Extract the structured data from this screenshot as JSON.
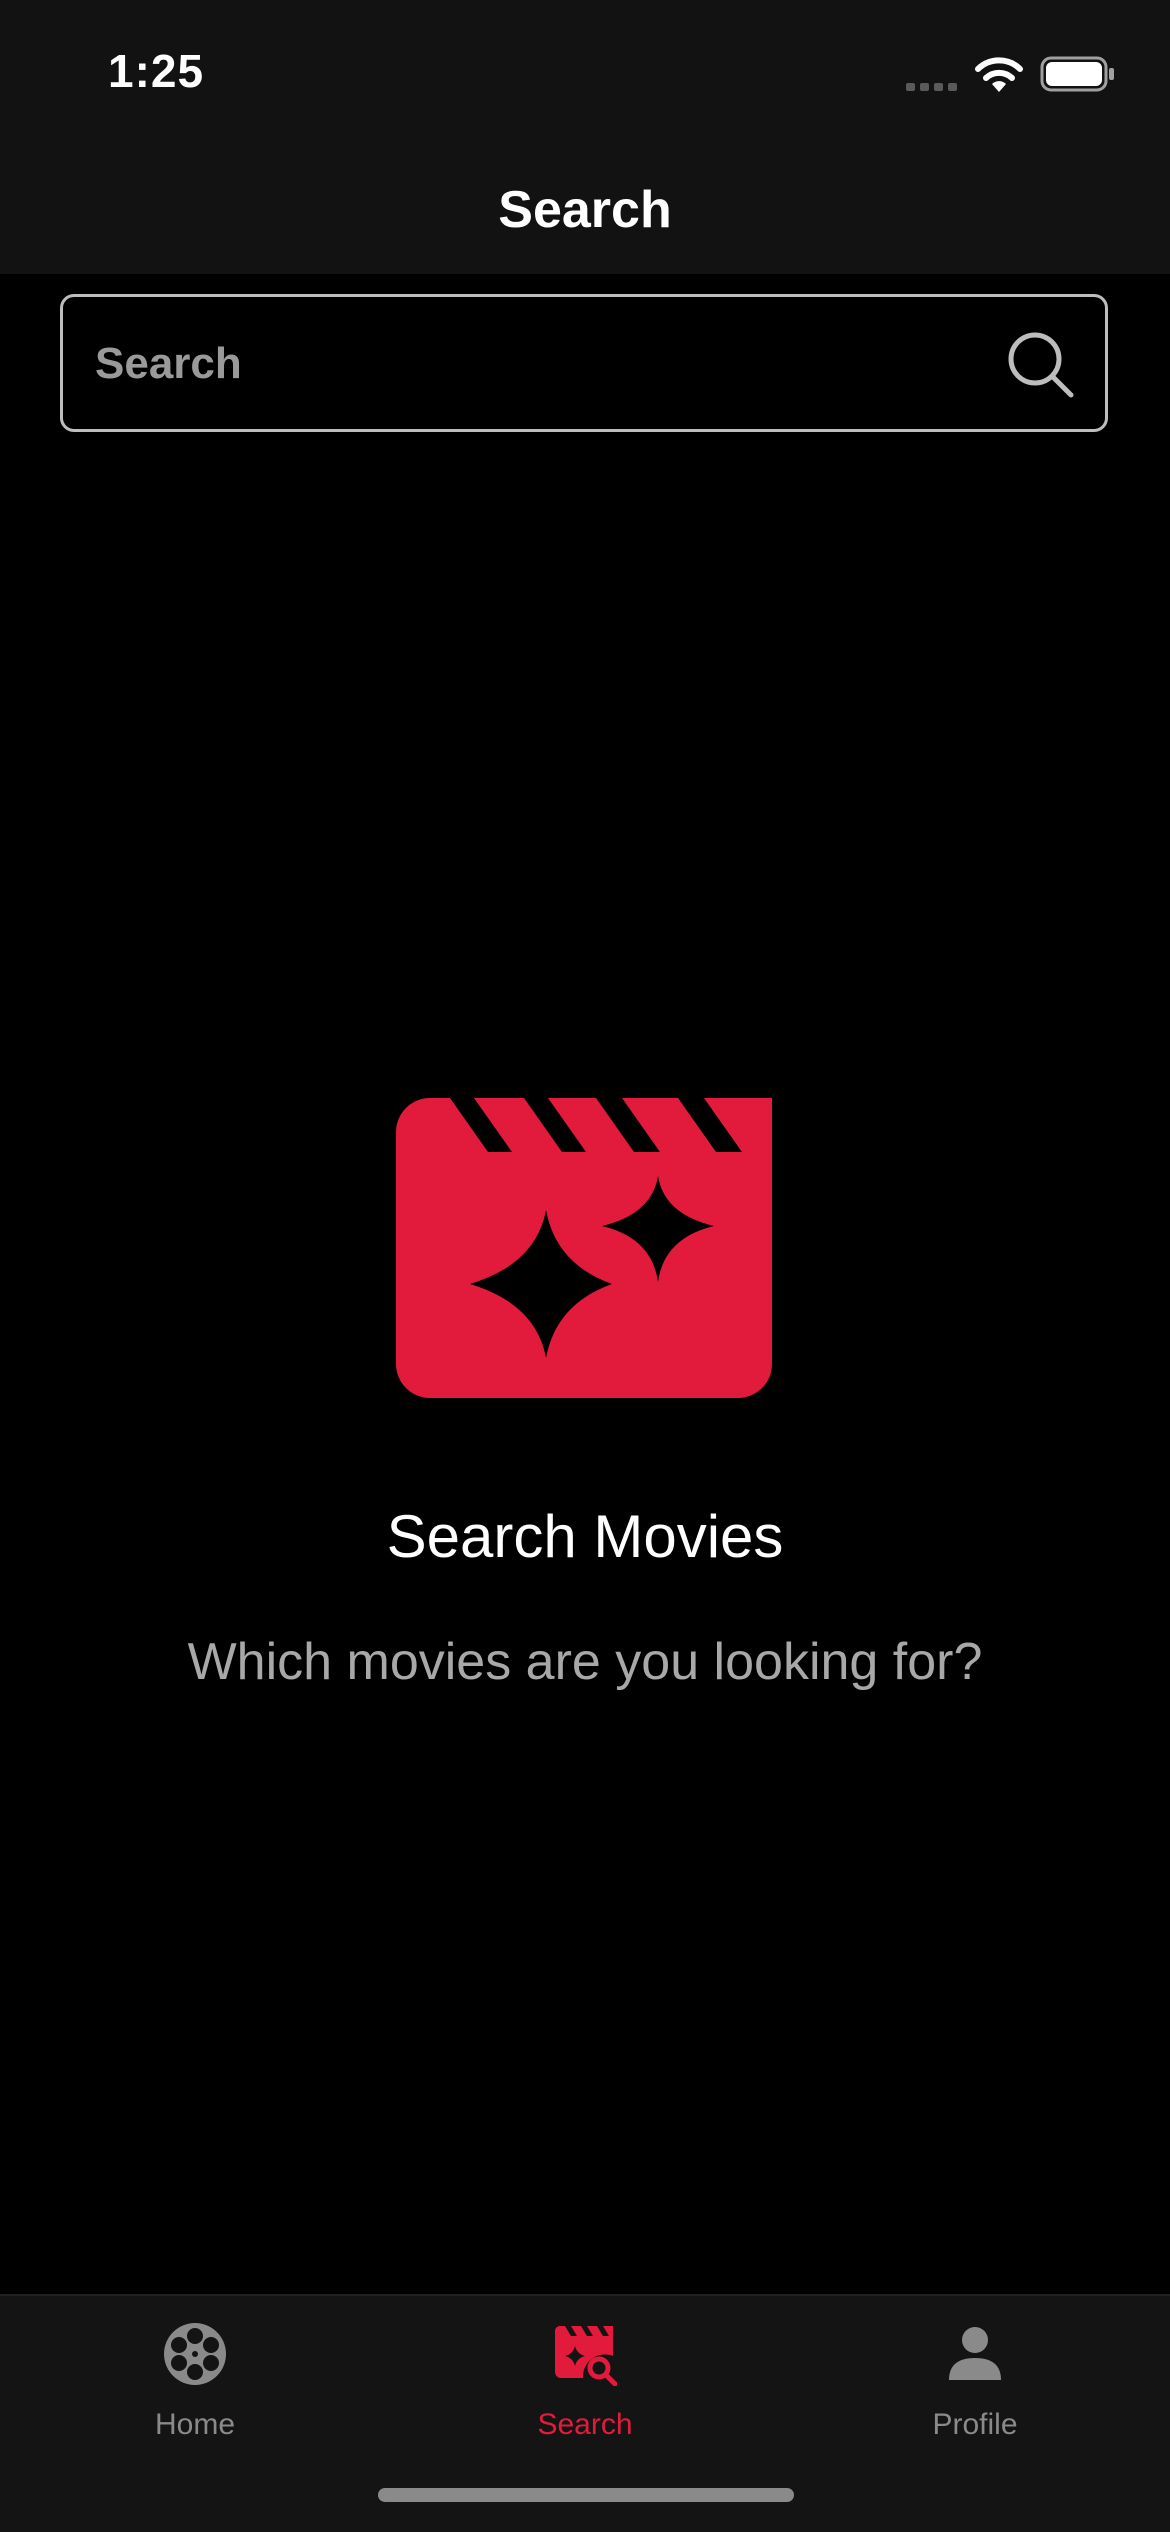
{
  "status_bar": {
    "time": "1:25"
  },
  "header": {
    "title": "Search"
  },
  "search": {
    "placeholder": "Search",
    "value": ""
  },
  "empty_state": {
    "icon": "clapperboard-sparkle-icon",
    "title": "Search Movies",
    "subtitle": "Which movies are you looking for?"
  },
  "tab_bar": {
    "tabs": [
      {
        "label": "Home",
        "icon": "film-reel-icon",
        "active": false
      },
      {
        "label": "Search",
        "icon": "clapperboard-search-icon",
        "active": true
      },
      {
        "label": "Profile",
        "icon": "person-icon",
        "active": false
      }
    ]
  },
  "colors": {
    "accent": "#e21b3c",
    "background": "#000000",
    "bar_background": "#121212",
    "inactive_tab": "#8a8a8a"
  }
}
